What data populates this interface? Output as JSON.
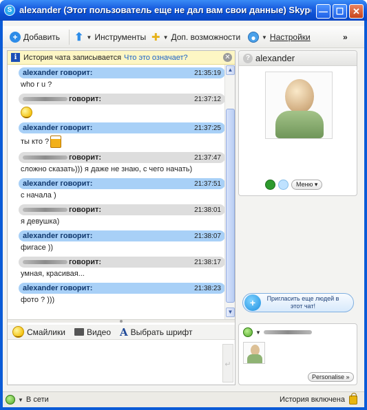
{
  "window": {
    "title": "alexander (Этот пользователь еще не дал вам свои данные) Skype™",
    "minimize_glyph": "—",
    "maximize_glyph": "☐",
    "close_glyph": "✕"
  },
  "toolbar": {
    "add_label": "Добавить",
    "tools_label": "Инструменты",
    "extras_label": "Доп. возможности",
    "settings_label": "Настройки",
    "overflow_label": "»"
  },
  "info_bar": {
    "text": "История чата записывается",
    "link": "Что это означает?"
  },
  "messages": [
    {
      "sender": "alexander говорит:",
      "time": "21:35:19",
      "text": "who r u ?",
      "self": true
    },
    {
      "sender": "говорит:",
      "time": "21:37:12",
      "text": "",
      "emoticon": "smile-emoticon",
      "self": false
    },
    {
      "sender": "alexander говорит:",
      "time": "21:37:25",
      "text": "ты кто ?",
      "emoticon": "beer-emoticon",
      "self": true
    },
    {
      "sender": "говорит:",
      "time": "21:37:47",
      "text": "сложно сказать))) я даже не знаю, с чего начать)",
      "self": false
    },
    {
      "sender": "alexander говорит:",
      "time": "21:37:51",
      "text": "с начала )",
      "self": true
    },
    {
      "sender": "говорит:",
      "time": "21:38:01",
      "text": "я девушка)",
      "self": false
    },
    {
      "sender": "alexander говорит:",
      "time": "21:38:07",
      "text": "фигасе ))",
      "self": true
    },
    {
      "sender": "говорит:",
      "time": "21:38:17",
      "text": "умная, красивая...",
      "self": false
    },
    {
      "sender": "alexander говорит:",
      "time": "21:38:23",
      "text": "фото ? )))",
      "self": true
    }
  ],
  "input_toolbar": {
    "emoticons_label": "Смайлики",
    "video_label": "Видео",
    "font_label": "Выбрать шрифт",
    "font_glyph": "A",
    "send_glyph": "↵"
  },
  "profile": {
    "name": "alexander",
    "status_glyph": "?",
    "menu_label": "Меню ▾"
  },
  "invite": {
    "plus_glyph": "+",
    "label": "Пригласить еще людей в этот чат!"
  },
  "self_panel": {
    "personalise_label": "Personalise »"
  },
  "statusbar": {
    "status_label": "В сети",
    "history_label": "История включена"
  },
  "colors": {
    "title_bar": "#0b4fd2",
    "own_message_header": "#a8d0f7",
    "other_message_header": "#dddddd",
    "info_bar": "#fdf6c4",
    "link": "#1b62c8"
  }
}
